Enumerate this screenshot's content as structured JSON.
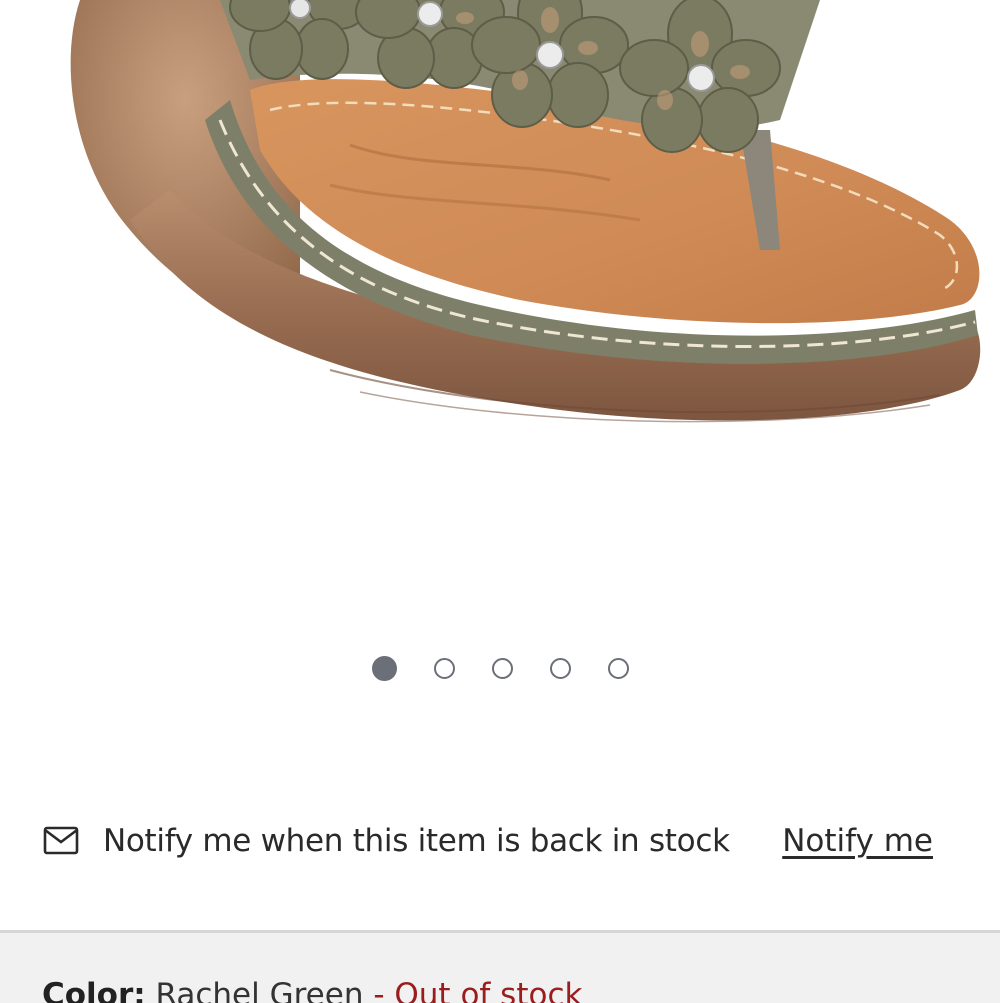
{
  "product_image": {
    "alt": "sandal-product-photo",
    "icon": "sandal-image"
  },
  "carousel": {
    "count": 5,
    "active_index": 0
  },
  "notify": {
    "icon": "mail-icon",
    "message": "Notify me when this item is back in stock",
    "link_label": "Notify me"
  },
  "color": {
    "label": "Color:",
    "value": "Rachel Green",
    "status": "- Out of stock"
  },
  "colors": {
    "status_out_of_stock": "#9b1c1c",
    "dot": "#6b6f77",
    "section_bg": "#f1f1f1"
  }
}
